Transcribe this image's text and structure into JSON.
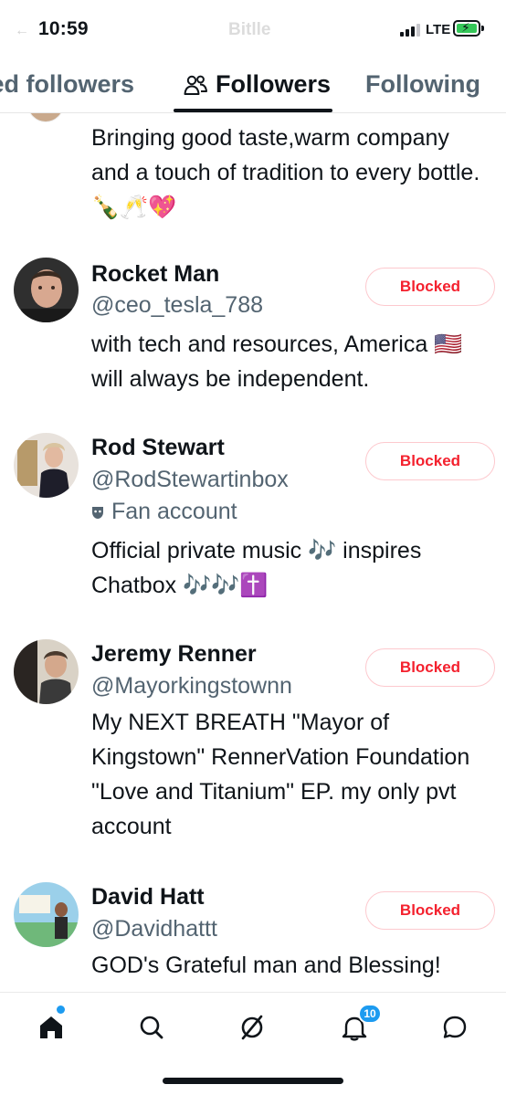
{
  "status_bar": {
    "time": "10:59",
    "network": "LTE",
    "ghost_title": "Bitlle"
  },
  "tabs": {
    "partial_label": "ied followers",
    "followers_label": "Followers",
    "following_label": "Following",
    "active": "Followers"
  },
  "list": {
    "top_bio": "Bringing good taste,warm company and a touch of tradition to every bottle.🍾🥂💖",
    "accounts": [
      {
        "name": "Rocket Man",
        "handle": "@ceo_tesla_788",
        "bio": "with tech and resources, America 🇺🇸 will always be independent.",
        "button": "Blocked",
        "avatar_color": "#3a3a3a"
      },
      {
        "name": "Rod Stewart",
        "handle": "@RodStewartinbox",
        "fan_label": "Fan account",
        "bio": "Official private music 🎶 inspires Chatbox 🎶🎶✝️",
        "button": "Blocked",
        "avatar_color": "#8a7a6a"
      },
      {
        "name": "Jeremy Renner",
        "handle": "@Mayorkingstownn",
        "bio": "My NEXT BREATH \"Mayor of Kingstown\" RennerVation Foundation \"Love and Titanium\" EP. my only pvt account",
        "button": "Blocked",
        "avatar_color": "#4a4a4a"
      },
      {
        "name": "David Hatt",
        "handle": "@Davidhattt",
        "bio": "GOD's Grateful man and Blessing!",
        "button": "Blocked",
        "avatar_color": "#5fa8d3"
      }
    ]
  },
  "bottom_nav": {
    "notifications_badge": "10",
    "icons": [
      "home-icon",
      "search-icon",
      "grok-icon",
      "bell-icon",
      "messages-icon"
    ]
  },
  "colors": {
    "text": "#0f1419",
    "secondary": "#536471",
    "blocked_red": "#f4212e",
    "accent_blue": "#1d9bf0"
  }
}
